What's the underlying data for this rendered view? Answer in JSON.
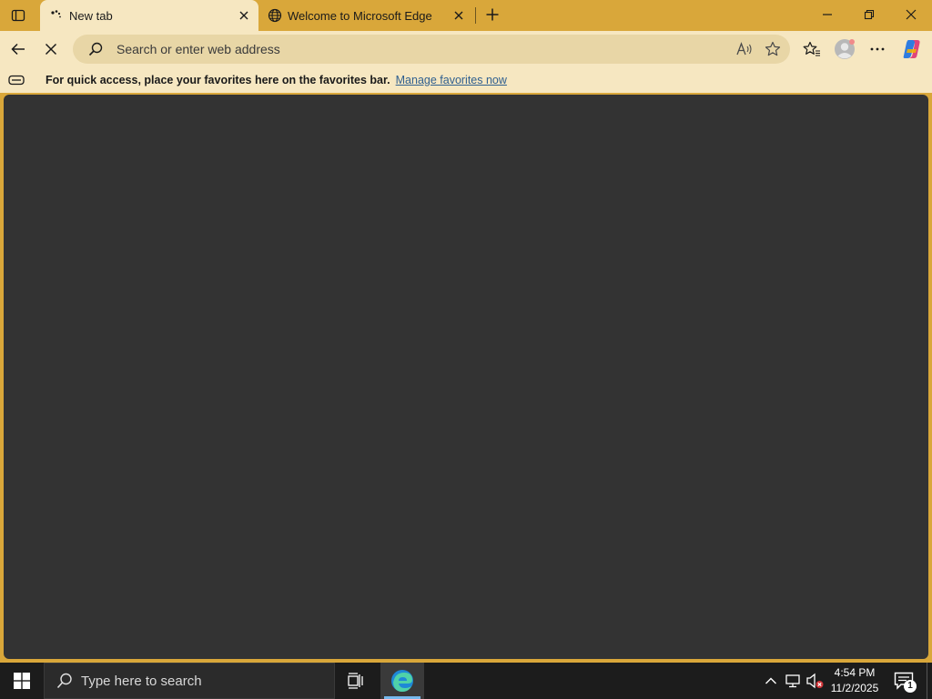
{
  "browser": {
    "tabs": [
      {
        "title": "New tab",
        "active": true
      },
      {
        "title": "Welcome to Microsoft Edge",
        "active": false
      }
    ],
    "address_bar": {
      "placeholder": "Search or enter web address",
      "value": ""
    },
    "favorites_bar": {
      "message": "For quick access, place your favorites here on the favorites bar.",
      "link": "Manage favorites now"
    }
  },
  "taskbar": {
    "search_placeholder": "Type here to search",
    "time": "4:54 PM",
    "date": "11/2/2025",
    "notification_count": "1"
  },
  "colors": {
    "titlebar": "#d9a73a",
    "toolbar": "#f6e7c1",
    "content": "#333333",
    "taskbar": "#1c1c1c",
    "link": "#2f5f8f"
  }
}
